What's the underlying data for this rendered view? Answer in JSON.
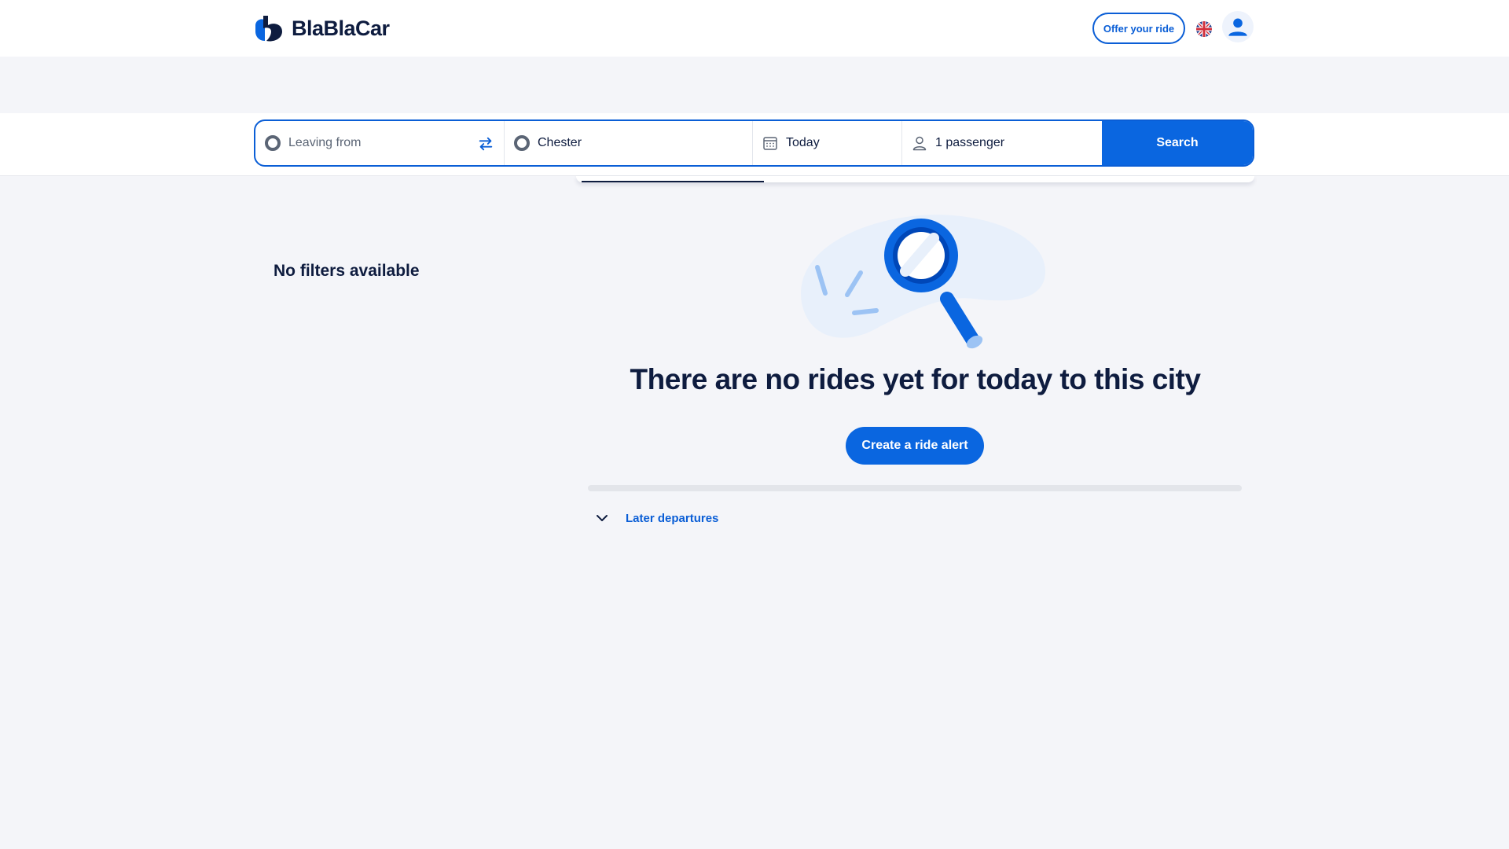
{
  "header": {
    "brand": "BlaBlaCar",
    "offer_ride": "Offer your ride",
    "language_icon": "uk-flag-icon",
    "profile_icon": "user-avatar-icon"
  },
  "search": {
    "from_placeholder": "Leaving from",
    "to_value": "Chester",
    "date_value": "Today",
    "passengers_value": "1 passenger",
    "search_label": "Search"
  },
  "filters": {
    "empty_label": "No filters available"
  },
  "results": {
    "empty_title": "There are no rides yet for today to this city",
    "alert_button": "Create a ride alert",
    "later_departures": "Later departures"
  },
  "colors": {
    "primary": "#0a66e0",
    "navy": "#0e1c3f",
    "page_bg": "#f4f5f9"
  }
}
